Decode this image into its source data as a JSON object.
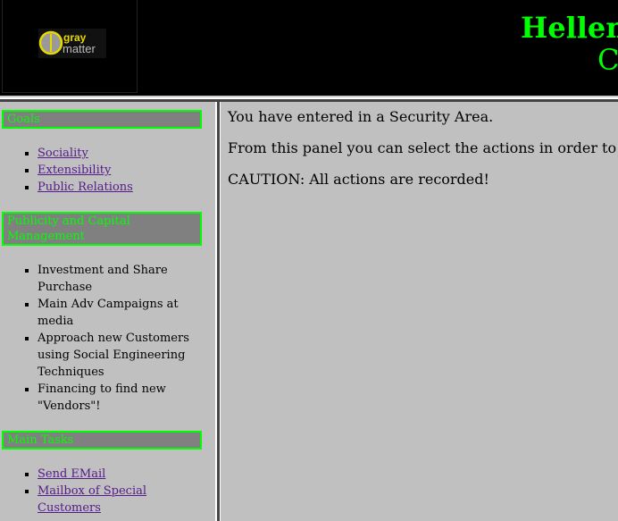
{
  "header": {
    "logo_text": "gray matter",
    "title": "Hellen",
    "subtitle": "C"
  },
  "sidebar": {
    "sections": [
      {
        "title": "Goals",
        "items": [
          {
            "label": "Sociality",
            "link": true
          },
          {
            "label": "Extensibility",
            "link": true
          },
          {
            "label": "Public Relations",
            "link": true
          }
        ]
      },
      {
        "title": "Publicity and Capital Management",
        "items": [
          {
            "label": "Investment and Share Purchase",
            "link": false
          },
          {
            "label": "Main Adv Campaigns at media",
            "link": false
          },
          {
            "label": "Approach new Customers using Social Engineering Techniques",
            "link": false
          },
          {
            "label": "Financing to find new \"Vendors\"!",
            "link": false
          }
        ]
      },
      {
        "title": "Main Tasks",
        "items": [
          {
            "label": "Send EMail",
            "link": true
          },
          {
            "label": "Mailbox of Special Customers",
            "link": true
          }
        ]
      }
    ]
  },
  "main": {
    "paragraphs": [
      "You have entered in a Security Area.",
      "From this panel you can select the actions in order to v",
      "CAUTION: All actions are recorded!"
    ]
  },
  "colors": {
    "accent": "#00ff00",
    "link": "#551a8b",
    "background": "#c0c0c0",
    "section_bg": "#808080"
  }
}
